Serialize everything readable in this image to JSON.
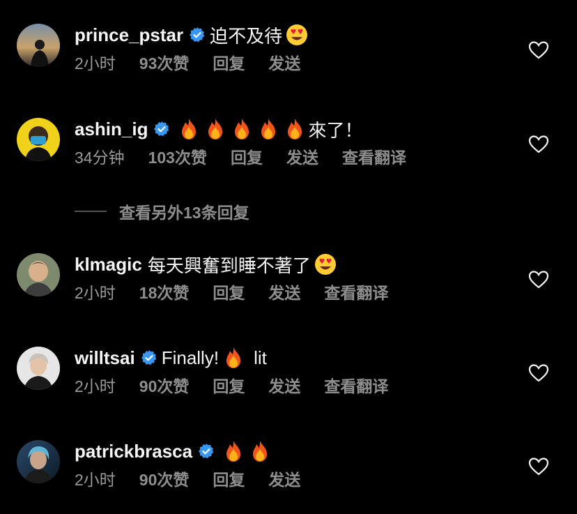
{
  "comments": [
    {
      "username": "prince_pstar",
      "verified": true,
      "text": "迫不及待",
      "emojis": [
        "heart-eyes"
      ],
      "time": "2小时",
      "likes": "93次赞",
      "reply": "回复",
      "send": "发送",
      "translate": ""
    },
    {
      "username": "ashin_ig",
      "verified": true,
      "text": "來了！",
      "emojis": [
        "fire",
        "fire",
        "fire",
        "fire",
        "fire"
      ],
      "time": "34分钟",
      "likes": "103次赞",
      "reply": "回复",
      "send": "发送",
      "translate": "查看翻译"
    },
    {
      "username": "klmagic",
      "verified": false,
      "text": "每天興奮到睡不著了",
      "emojis": [
        "heart-eyes"
      ],
      "time": "2小时",
      "likes": "18次赞",
      "reply": "回复",
      "send": "发送",
      "translate": "查看翻译"
    },
    {
      "username": "willtsai",
      "verified": true,
      "text": "Finally!",
      "text_after": "lit",
      "emojis": [
        "fire"
      ],
      "time": "2小时",
      "likes": "90次赞",
      "reply": "回复",
      "send": "发送",
      "translate": "查看翻译"
    },
    {
      "username": "patrickbrasca",
      "verified": true,
      "text": "",
      "emojis": [
        "fire",
        "fire"
      ],
      "time": "2小时",
      "likes": "90次赞",
      "reply": "回复",
      "send": "发送",
      "translate": ""
    }
  ],
  "view_more_replies": "查看另外13条回复",
  "colors": {
    "background": "#000000",
    "primary_text": "#f5f5f5",
    "secondary_text": "#8e8e8e",
    "verified_badge": "#3897f0"
  }
}
